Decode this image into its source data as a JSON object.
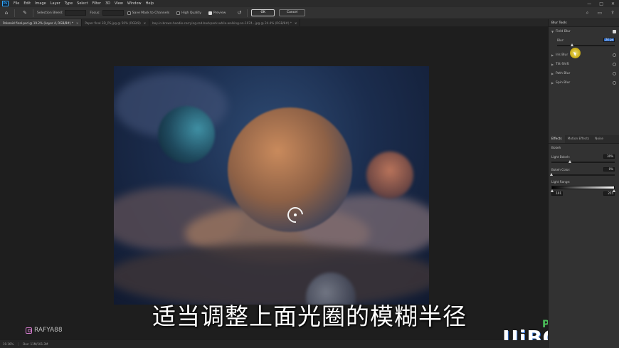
{
  "app": {
    "logo": "Ps"
  },
  "menu": [
    "File",
    "Edit",
    "Image",
    "Layer",
    "Type",
    "Select",
    "Filter",
    "3D",
    "View",
    "Window",
    "Help"
  ],
  "window_controls": [
    "—",
    "□",
    "✕"
  ],
  "options_bar": {
    "selection_bleed_label": "Selection Bleed:",
    "focus_label": "Focus:",
    "save_mask_label": "Save Mask to Channels",
    "high_quality_label": "High Quality",
    "preview_label": "Preview",
    "ok_label": "OK",
    "cancel_label": "Cancel"
  },
  "tabs": [
    {
      "label": "Polaroid final.psd @ 19.2% (Layer 4, RGB/8#) *",
      "active": true
    },
    {
      "label": "Paper final 3D_PS.jpg @ 50% (RGB/8)",
      "active": false
    },
    {
      "label": "boy-in-brown-hoodie-carrying-red-backpack-while-walking-on-1074...jpg @ 24.4% (RGB/8#) *",
      "active": false
    }
  ],
  "blur_tools": {
    "header": "Blur Tools",
    "field_blur": {
      "label": "Field Blur",
      "param_label": "Blur:",
      "value": "24 px",
      "slider_value_fraction": 0.27
    },
    "others": [
      "Iris Blur",
      "Tilt-Shift",
      "Path Blur",
      "Spin Blur"
    ]
  },
  "effects_panel": {
    "tabs": [
      "Effects",
      "Motion Effects",
      "Noise"
    ],
    "bokeh_label": "Bokeh",
    "light_bokeh_label": "Light Bokeh:",
    "light_bokeh_value": "30%",
    "light_bokeh_fraction": 0.3,
    "bokeh_color_label": "Bokeh Color:",
    "bokeh_color_value": "0%",
    "bokeh_color_fraction": 0.0,
    "light_range_label": "Light Range:",
    "range_low": "191",
    "range_high": "255"
  },
  "status": {
    "zoom": "19.16%",
    "doc": "Doc: 11M/101.3M"
  },
  "overlay": {
    "subtitle": "适当调整上面光圈的模糊半径",
    "creator": "RAFYA88",
    "watermark_ps": "PS",
    "watermark_url": "UiBQ.CoM"
  },
  "colors": {
    "accent": "#31a8ff",
    "selection": "#2f6fcf",
    "cursor_highlight": "#e1c21f"
  }
}
